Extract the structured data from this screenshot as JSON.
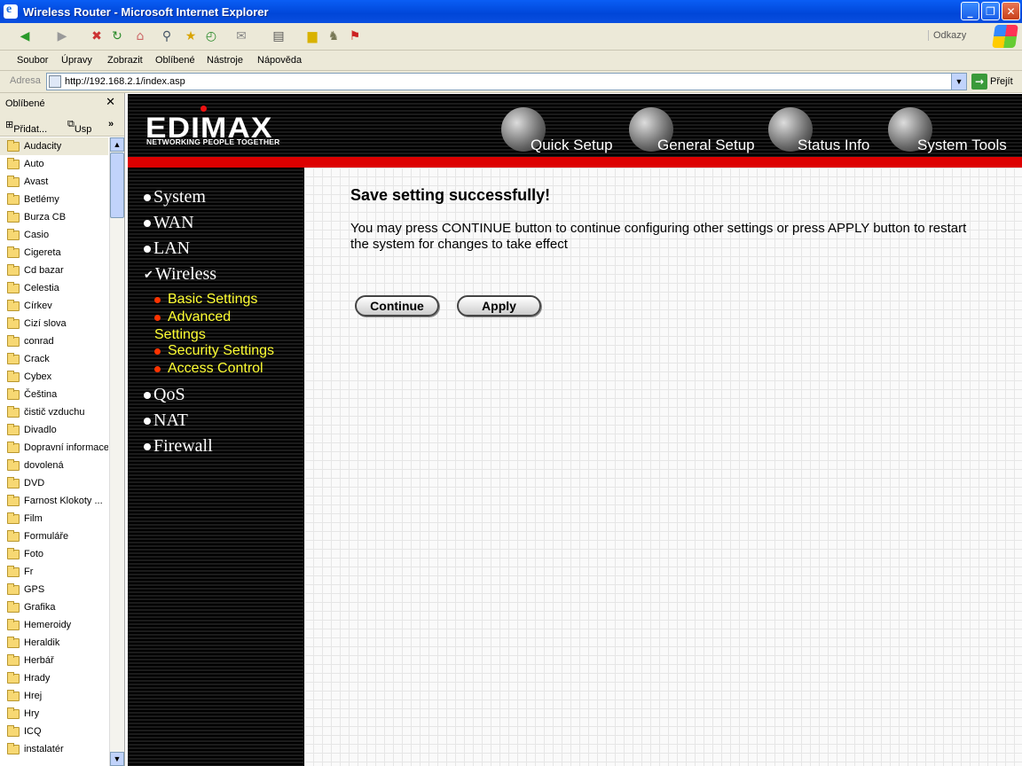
{
  "window": {
    "title": "Wireless Router - Microsoft Internet Explorer"
  },
  "menu": [
    "Soubor",
    "Úpravy",
    "Zobrazit",
    "Oblíbené",
    "Nástroje",
    "Nápověda"
  ],
  "toolbar": {
    "links_label": "Odkazy"
  },
  "address": {
    "label": "Adresa",
    "url": "http://192.168.2.1/index.asp",
    "go_label": "Přejít"
  },
  "favorites": {
    "title": "Oblíbené",
    "add_label": "Přidat...",
    "organize_label": "Usp",
    "items": [
      "Audacity",
      "Auto",
      "Avast",
      "Betlémy",
      "Burza CB",
      "Casio",
      "Cigereta",
      "Cd bazar",
      "Celestia",
      "Církev",
      "Cizí slova",
      "conrad",
      "Crack",
      "Cybex",
      "Čeština",
      "čistič vzduchu",
      "Divadlo",
      "Dopravní informace",
      "dovolená",
      "DVD",
      "Farnost Klokoty ...",
      "Film",
      "Formuláře",
      "Foto",
      "Fr",
      "GPS",
      "Grafika",
      "Hemeroidy",
      "Heraldik",
      "Herbář",
      "Hrady",
      "Hrej",
      "Hry",
      "ICQ",
      "instalatér"
    ]
  },
  "router": {
    "logo": "EDIMAX",
    "tagline": "NETWORKING PEOPLE TOGETHER",
    "nav": [
      "Quick Setup",
      "General Setup",
      "Status Info",
      "System Tools"
    ],
    "menu": {
      "system": "System",
      "wan": "WAN",
      "lan": "LAN",
      "wireless": "Wireless",
      "sub": {
        "basic": "Basic Settings",
        "advanced1": "Advanced",
        "advanced2": "Settings",
        "security": "Security Settings",
        "access": "Access Control"
      },
      "qos": "QoS",
      "nat": "NAT",
      "firewall": "Firewall"
    },
    "heading": "Save setting successfully!",
    "message": "You may press CONTINUE button to continue configuring other settings or press APPLY button to restart the system for changes to take effect",
    "continue_label": "Continue",
    "apply_label": "Apply"
  }
}
